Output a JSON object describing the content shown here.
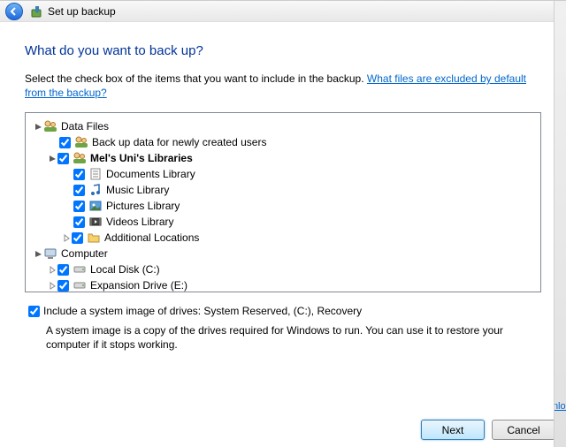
{
  "titlebar": {
    "title": "Set up backup"
  },
  "heading": "What do you want to back up?",
  "instruction": "Select the check box of the items that you want to include in the backup. ",
  "excluded_link": "What files are excluded by default from the backup?",
  "tree": {
    "data_files": {
      "label": "Data Files",
      "new_users": "Back up data for newly created users",
      "user_libs": "Mel's Uni's Libraries",
      "docs": "Documents Library",
      "music": "Music Library",
      "pictures": "Pictures Library",
      "videos": "Videos Library",
      "additional": "Additional Locations"
    },
    "computer": {
      "label": "Computer",
      "c": "Local Disk (C:)",
      "e": "Expansion Drive (E:)"
    }
  },
  "system_image": {
    "label": "Include a system image of drives: System Reserved, (C:), Recovery",
    "desc": "A system image is a copy of the drives required for Windows to run. You can use it to restore your computer if it stops working."
  },
  "buttons": {
    "next": "Next",
    "cancel": "Cancel"
  },
  "edge_text": "wnloa"
}
